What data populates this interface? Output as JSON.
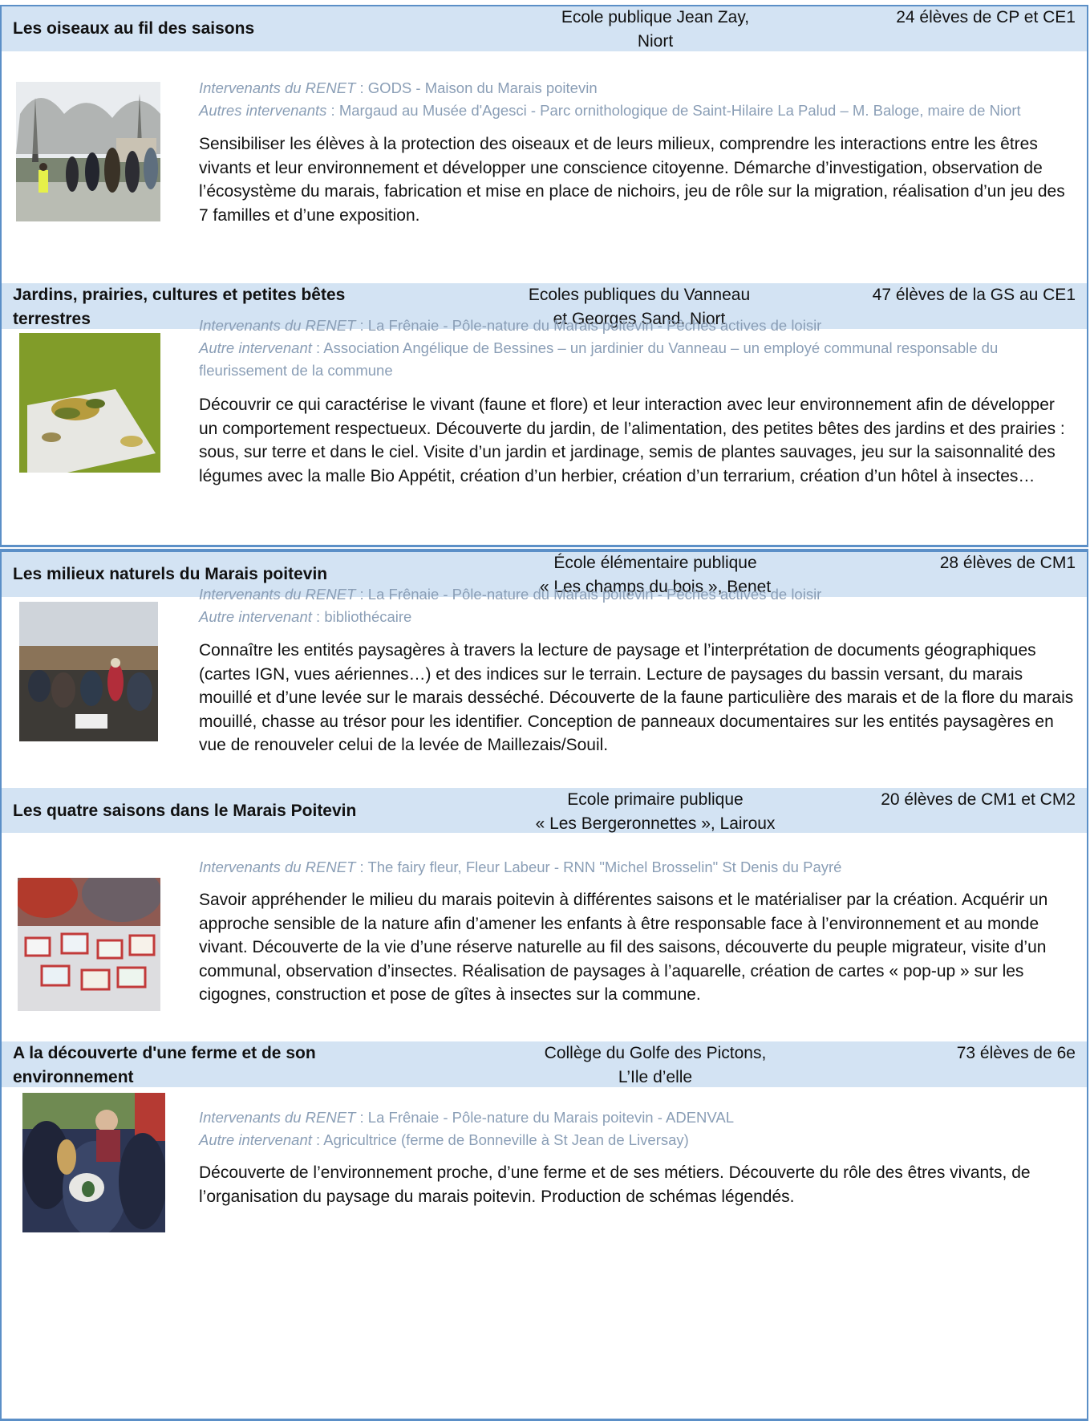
{
  "projects": [
    {
      "title": "Les oiseaux au fil des  saisons",
      "school": [
        "Ecole publique Jean Zay,",
        "Niort"
      ],
      "pupils": "24 élèves de CP et CE1",
      "renet_label": "Intervenants du RENET",
      "renet": " : GODS - Maison du Marais poitevin",
      "other_label": "Autres intervenants",
      "other": " : Margaud au Musée d'Agesci - Parc ornithologique de Saint-Hilaire La Palud – M. Baloge, maire de Niort",
      "description": "Sensibiliser les élèves à la protection des oiseaux et de leurs milieux, comprendre les interactions entre les êtres vivants et leur environnement et développer une conscience citoyenne. Démarche d’investigation, observation de l’écosystème du marais, fabrication et mise en place de nichoirs, jeu de rôle sur la migration, réalisation d’un jeu des 7 familles et d’une exposition."
    },
    {
      "title": "Jardins, prairies, cultures et petites bêtes terrestres",
      "school": [
        "Ecoles publiques du Vanneau",
        "et Georges Sand, Niort"
      ],
      "pupils": "47 élèves de la GS au CE1",
      "renet_label": "Intervenants du RENET",
      "renet": " : La Frênaie - Pôle-nature du Marais poitevin - Pêches actives de loisir",
      "other_label": "Autre intervenant",
      "other": " : Association Angélique de Bessines – un jardinier du Vanneau – un employé communal responsable du fleurissement de la commune",
      "description": "Découvrir ce qui caractérise le vivant (faune et flore) et leur interaction avec leur environnement afin de développer un comportement respectueux. Découverte du jardin, de l’alimentation, des petites bêtes des jardins et des prairies : sous, sur terre et dans le ciel. Visite d’un jardin et jardinage, semis de plantes sauvages,  jeu sur la saisonnalité des légumes avec la malle Bio Appétit, création d’un herbier, création d’un terrarium, création d’un hôtel à insectes…"
    },
    {
      "title": "Les milieux naturels du Marais poitevin",
      "school": [
        "École élémentaire publique",
        "« Les champs du bois », Benet"
      ],
      "pupils": "28 élèves de CM1",
      "renet_label": "Intervenants du RENET",
      "renet": " : La Frênaie - Pôle-nature du Marais poitevin - Pêches actives de loisir",
      "other_label": "Autre intervenant",
      "other": " : bibliothécaire",
      "description": "Connaître les entités paysagères à travers la lecture de paysage et l’interprétation de documents géographiques (cartes IGN, vues aériennes…) et des indices sur le terrain. Lecture de paysages du bassin versant, du marais mouillé et d’une levée sur le marais desséché. Découverte de la faune particulière des marais et de la flore du marais mouillé, chasse au trésor pour les identifier. Conception de panneaux documentaires sur les entités paysagères en vue de renouveler celui de la levée de Maillezais/Souil."
    },
    {
      "title": "Les quatre saisons dans le Marais Poitevin",
      "school": [
        "Ecole primaire publique",
        "« Les Bergeronnettes », Lairoux"
      ],
      "pupils": "20 élèves de CM1 et CM2",
      "renet_label": "Intervenants du RENET",
      "renet": " : The fairy fleur, Fleur Labeur - RNN \"Michel Brosselin\" St Denis du Payré",
      "other_label": "",
      "other": "",
      "description": "Savoir appréhender le milieu du marais poitevin à différentes saisons et le matérialiser par la création. Acquérir un approche sensible de la nature afin d’amener les enfants à être responsable face à l’environnement et au monde vivant. Découverte de la vie d’une réserve naturelle au fil des saisons, découverte du peuple migrateur, visite d’un communal, observation d’insectes. Réalisation de paysages à l’aquarelle, création de cartes « pop-up » sur les cigognes, construction et pose de gîtes à insectes sur la commune."
    },
    {
      "title": "A la découverte d'une ferme et de son environnement",
      "school": [
        "Collège du Golfe des Pictons,",
        "L’Ile d’elle"
      ],
      "pupils": "73 élèves de 6e",
      "renet_label": "Intervenants du RENET",
      "renet": " : La Frênaie - Pôle-nature du Marais poitevin - ADENVAL",
      "other_label": "Autre intervenant",
      "other": " : Agricultrice (ferme de Bonneville à St Jean de Liversay)",
      "description": "Découverte de l’environnement proche, d’une ferme et de ses métiers. Découverte du rôle des êtres vivants, de l’organisation du paysage du marais poitevin. Production de schémas légendés."
    }
  ]
}
